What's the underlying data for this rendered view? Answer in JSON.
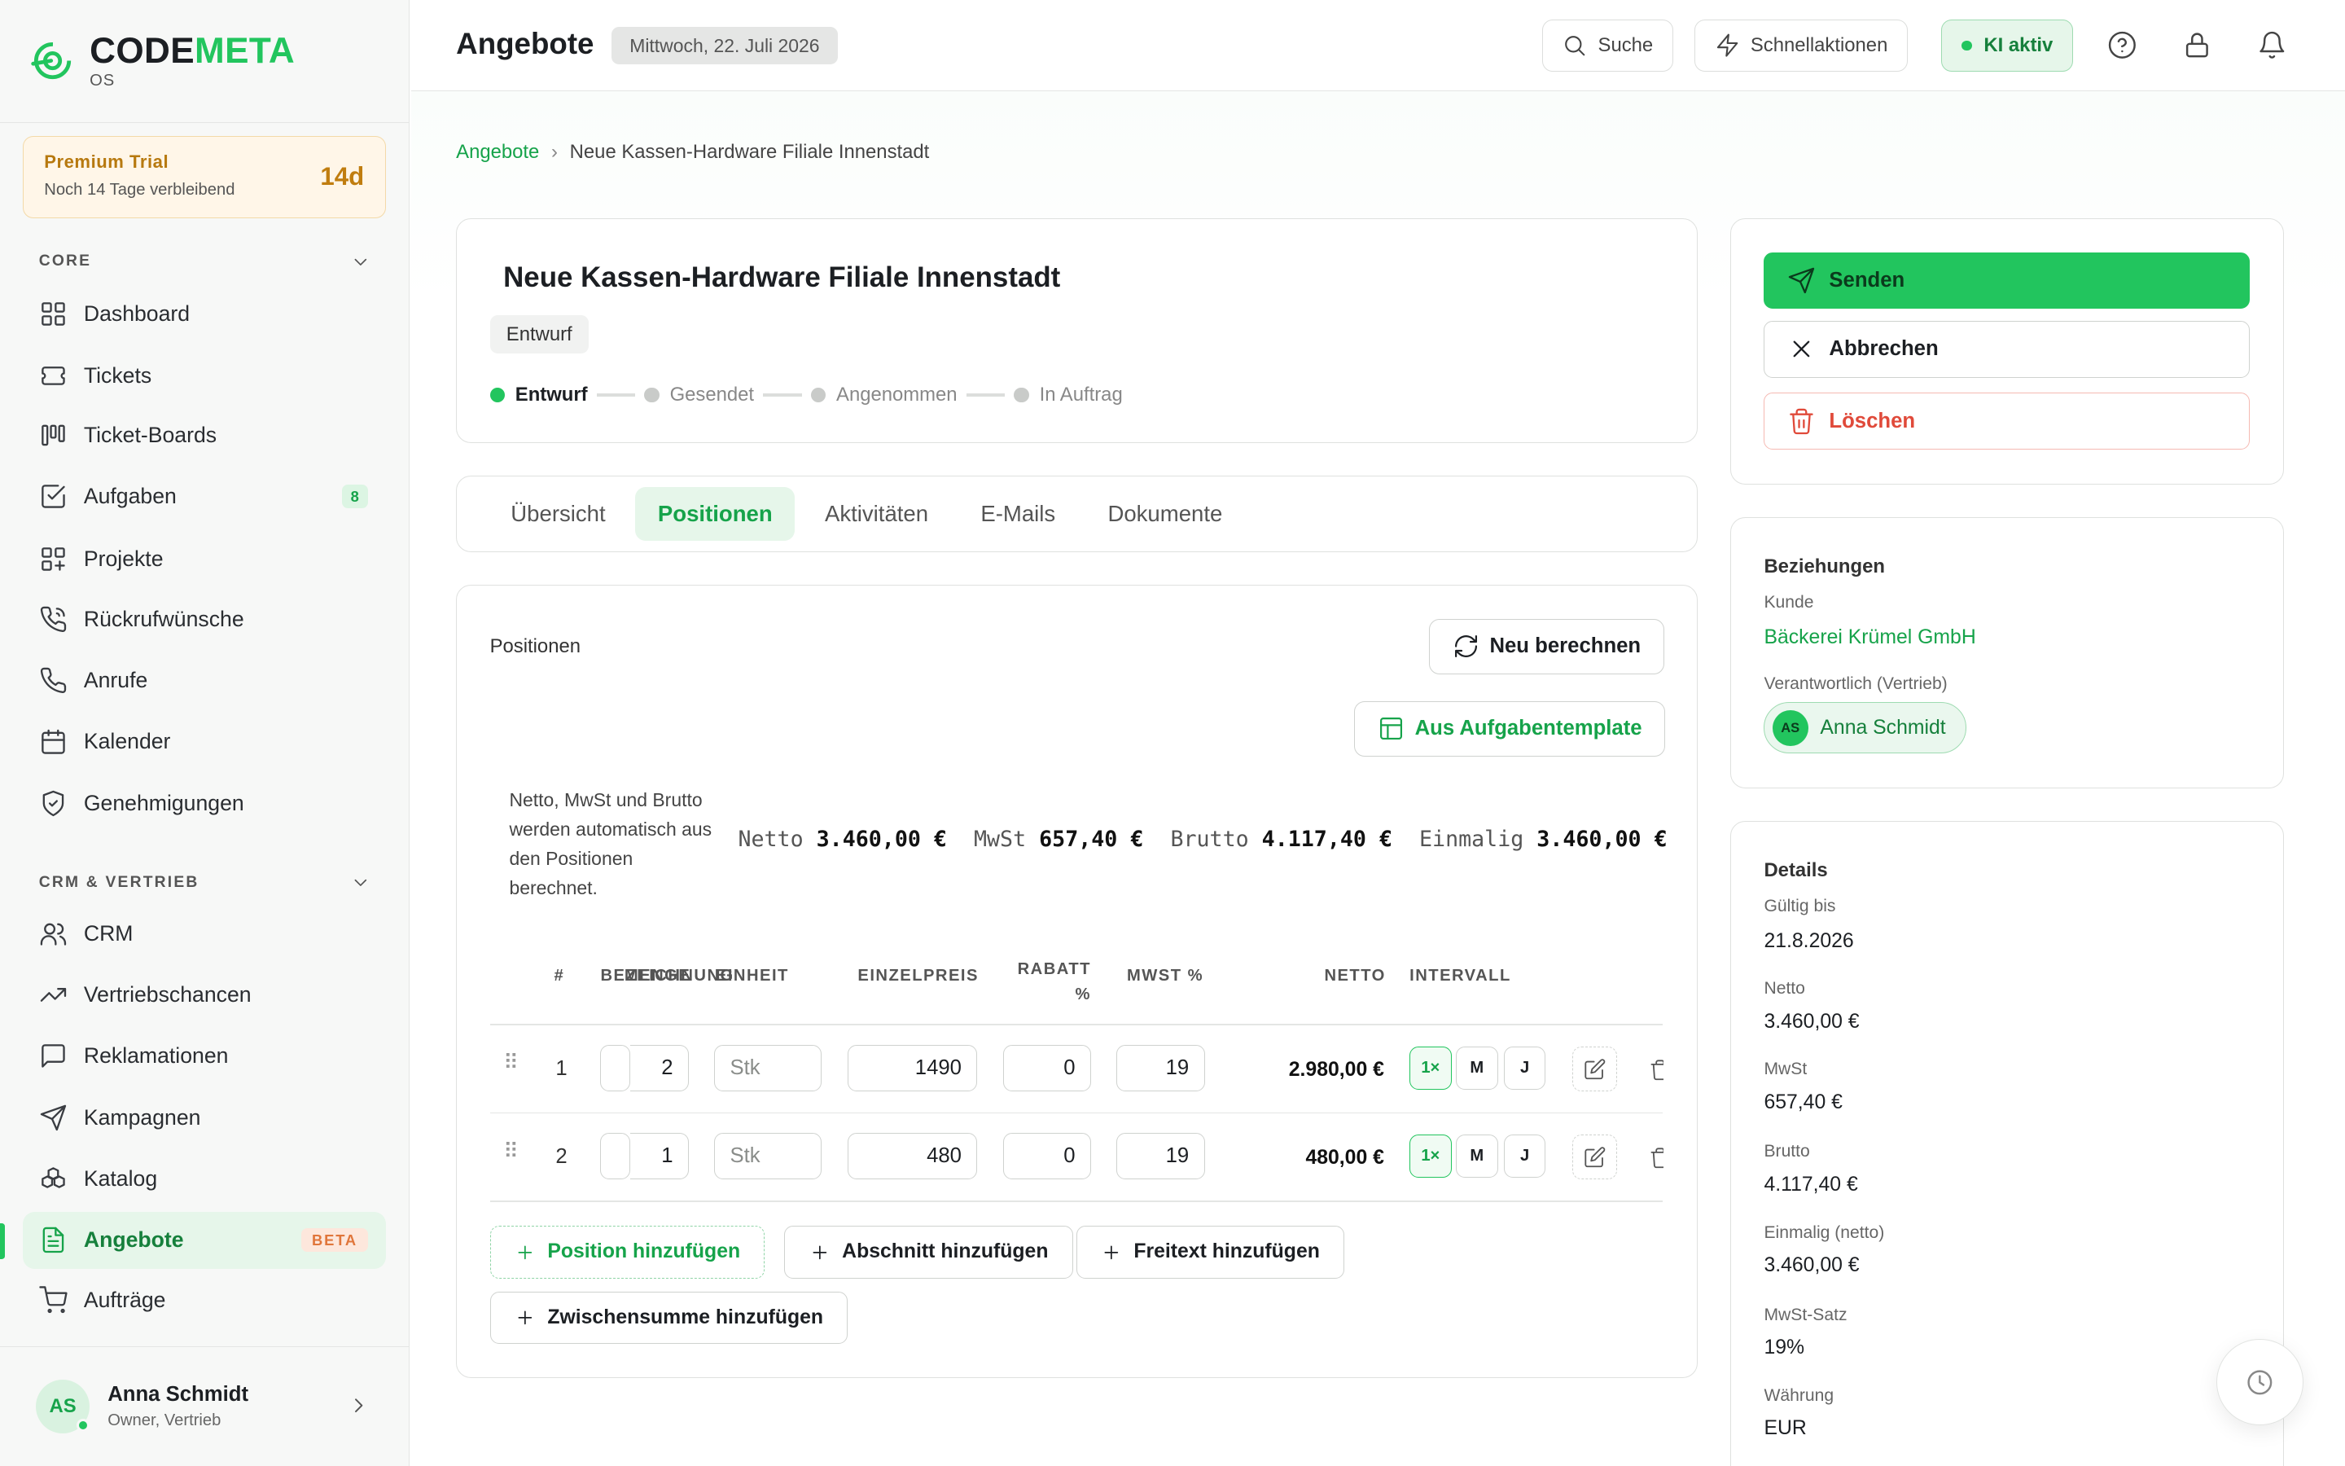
{
  "brand": {
    "name_dark": "CODE",
    "name_green": "META",
    "sub": "OS",
    "green": "#22c55e"
  },
  "trial": {
    "title": "Premium Trial",
    "subtitle": "Noch 14 Tage verbleibend",
    "days": "14d"
  },
  "sidebar": {
    "sections": [
      {
        "label": "CORE",
        "items": [
          {
            "label": "Dashboard",
            "icon": "grid-icon"
          },
          {
            "label": "Tickets",
            "icon": "ticket-icon"
          },
          {
            "label": "Ticket-Boards",
            "icon": "board-icon"
          },
          {
            "label": "Aufgaben",
            "icon": "checkbox-icon",
            "badge": "8"
          },
          {
            "label": "Projekte",
            "icon": "projects-icon"
          },
          {
            "label": "Rückrufwünsche",
            "icon": "callback-icon"
          },
          {
            "label": "Anrufe",
            "icon": "phone-icon"
          },
          {
            "label": "Kalender",
            "icon": "calendar-icon"
          },
          {
            "label": "Genehmigungen",
            "icon": "shield-icon"
          }
        ]
      },
      {
        "label": "CRM & VERTRIEB",
        "items": [
          {
            "label": "CRM",
            "icon": "users-icon"
          },
          {
            "label": "Vertriebschancen",
            "icon": "trending-icon"
          },
          {
            "label": "Reklamationen",
            "icon": "message-icon"
          },
          {
            "label": "Kampagnen",
            "icon": "send-icon"
          },
          {
            "label": "Katalog",
            "icon": "boxes-icon"
          },
          {
            "label": "Angebote",
            "icon": "document-icon",
            "beta": "BETA",
            "active": true
          },
          {
            "label": "Aufträge",
            "icon": "cart-icon"
          }
        ]
      }
    ]
  },
  "user": {
    "initials": "AS",
    "name": "Anna Schmidt",
    "role": "Owner, Vertrieb"
  },
  "topbar": {
    "title": "Angebote",
    "date": "Mittwoch, 22. Juli 2026",
    "search": "Suche",
    "quick": "Schnellaktionen",
    "ki": "KI aktiv"
  },
  "breadcrumb": {
    "root": "Angebote",
    "current": "Neue Kassen-Hardware Filiale Innenstadt"
  },
  "offer": {
    "title": "Neue Kassen-Hardware Filiale Innenstadt",
    "status": "Entwurf",
    "steps": [
      "Entwurf",
      "Gesendet",
      "Angenommen",
      "In Auftrag"
    ]
  },
  "tabs": [
    "Übersicht",
    "Positionen",
    "Aktivitäten",
    "E-Mails",
    "Dokumente"
  ],
  "positions": {
    "label": "Positionen",
    "recalc": "Neu berechnen",
    "template": "Aus Aufgabentemplate",
    "note": "Netto, MwSt und Brutto werden automatisch aus den Positionen berechnet.",
    "sums": [
      {
        "k": "Netto",
        "v": "3.460,00 €"
      },
      {
        "k": "MwSt",
        "v": "657,40 €"
      },
      {
        "k": "Brutto",
        "v": "4.117,40 €"
      },
      {
        "k": "Einmalig",
        "v": "3.460,00 €"
      }
    ],
    "columns": {
      "num": "#",
      "bez": "BEZEICHNUNG",
      "menge": "MENGE",
      "einheit": "EINHEIT",
      "preis": "EINZELPREIS",
      "rabatt": "RABATT %",
      "mwst": "MWST %",
      "netto": "NETTO",
      "intervall": "INTERVALL"
    },
    "rows": [
      {
        "num": "1",
        "menge": "2",
        "einheit": "Stk",
        "preis": "1490",
        "rabatt": "0",
        "mwst": "19",
        "netto": "2.980,00 €",
        "iv": [
          "1×",
          "M",
          "J"
        ]
      },
      {
        "num": "2",
        "menge": "1",
        "einheit": "Stk",
        "preis": "480",
        "rabatt": "0",
        "mwst": "19",
        "netto": "480,00 €",
        "iv": [
          "1×",
          "M",
          "J"
        ]
      }
    ],
    "add": {
      "position": "Position hinzufügen",
      "section": "Abschnitt hinzufügen",
      "freetext": "Freitext hinzufügen",
      "subtotal": "Zwischensumme hinzufügen"
    }
  },
  "actions": {
    "send": "Senden",
    "cancel": "Abbrechen",
    "delete": "Löschen"
  },
  "relations": {
    "title": "Beziehungen",
    "customer_label": "Kunde",
    "customer": "Bäckerei Krümel GmbH",
    "owner_label": "Verantwortlich (Vertrieb)",
    "owner_initials": "AS",
    "owner": "Anna Schmidt"
  },
  "details": {
    "title": "Details",
    "fields": [
      {
        "label": "Gültig bis",
        "value": "21.8.2026"
      },
      {
        "label": "Netto",
        "value": "3.460,00 €"
      },
      {
        "label": "MwSt",
        "value": "657,40 €"
      },
      {
        "label": "Brutto",
        "value": "4.117,40 €"
      },
      {
        "label": "Einmalig (netto)",
        "value": "3.460,00 €"
      },
      {
        "label": "MwSt-Satz",
        "value": "19%"
      },
      {
        "label": "Währung",
        "value": "EUR"
      }
    ]
  }
}
